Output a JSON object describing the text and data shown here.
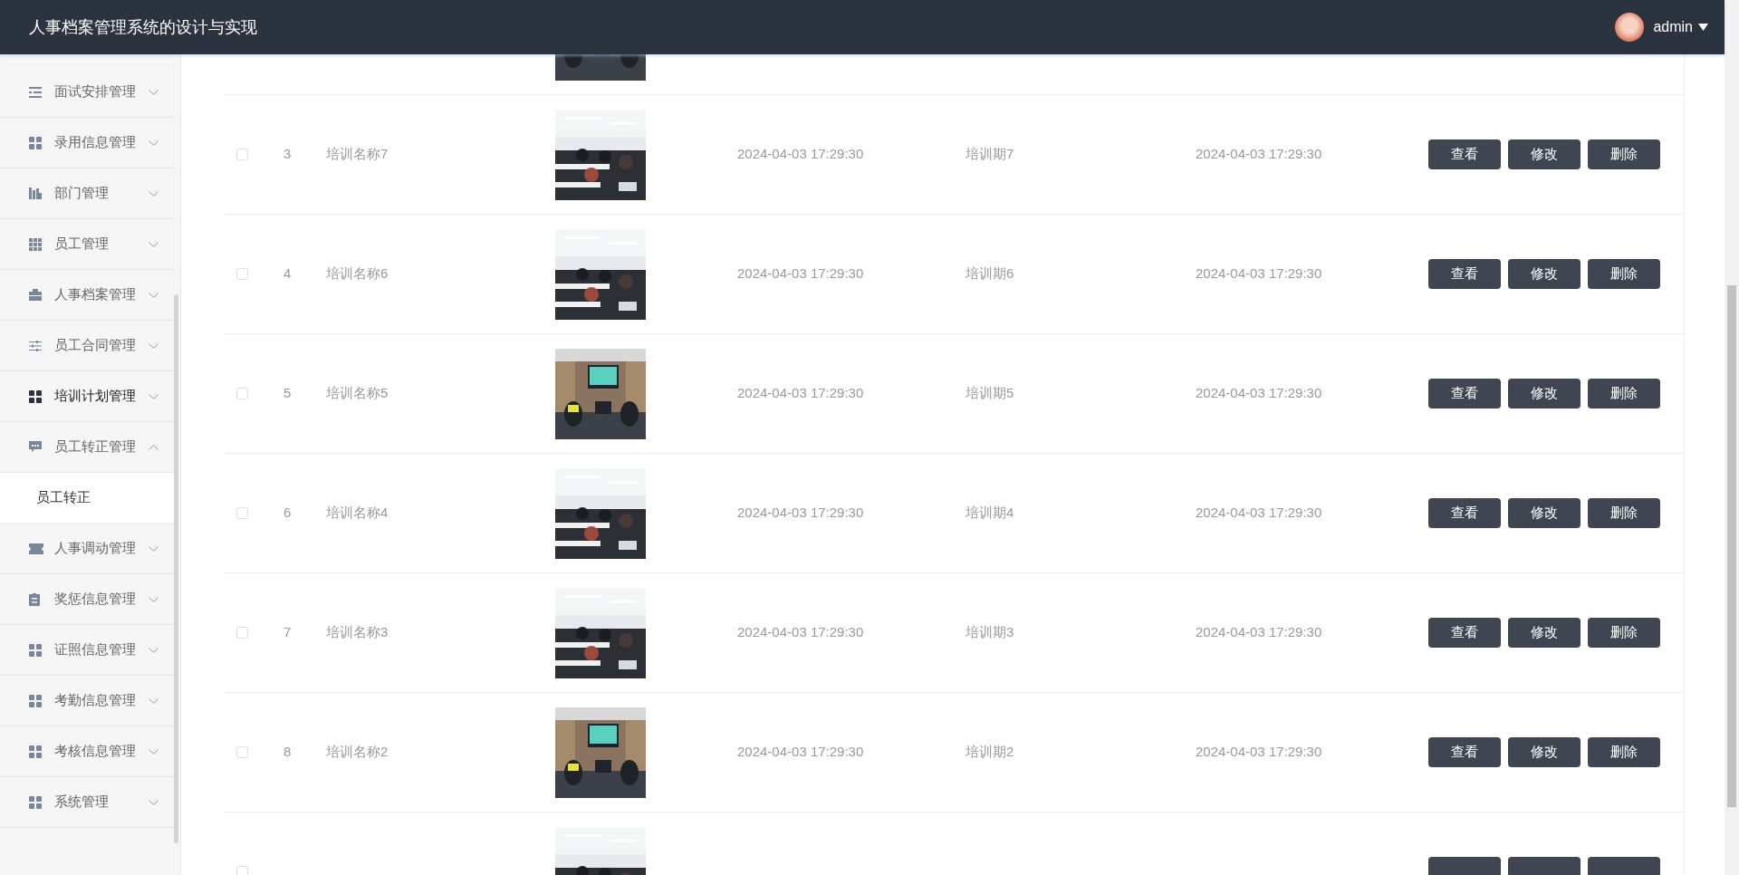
{
  "header": {
    "title": "人事档案管理系统的设计与实现",
    "user": "admin"
  },
  "sidebar": {
    "items": [
      {
        "label": "面试安排管理",
        "expanded": false,
        "selected": false
      },
      {
        "label": "录用信息管理",
        "expanded": false,
        "selected": false
      },
      {
        "label": "部门管理",
        "expanded": false,
        "selected": false
      },
      {
        "label": "员工管理",
        "expanded": false,
        "selected": false
      },
      {
        "label": "人事档案管理",
        "expanded": false,
        "selected": false
      },
      {
        "label": "员工合同管理",
        "expanded": false,
        "selected": false
      },
      {
        "label": "培训计划管理",
        "expanded": false,
        "selected": true
      },
      {
        "label": "员工转正管理",
        "expanded": true,
        "selected": false,
        "children": [
          {
            "label": "员工转正"
          }
        ]
      },
      {
        "label": "人事调动管理",
        "expanded": false,
        "selected": false
      },
      {
        "label": "奖惩信息管理",
        "expanded": false,
        "selected": false
      },
      {
        "label": "证照信息管理",
        "expanded": false,
        "selected": false
      },
      {
        "label": "考勤信息管理",
        "expanded": false,
        "selected": false
      },
      {
        "label": "考核信息管理",
        "expanded": false,
        "selected": false
      },
      {
        "label": "系统管理",
        "expanded": false,
        "selected": false
      }
    ]
  },
  "table": {
    "rows": [
      {
        "kind": "cut_top"
      },
      {
        "kind": "full",
        "checked": false,
        "index": "3",
        "name": "培训名称7",
        "created": "2024-04-03 17:29:30",
        "period": "培训期7",
        "time": "2024-04-03 17:29:30",
        "buttons": [
          "查看",
          "修改",
          "删除"
        ]
      },
      {
        "kind": "full",
        "checked": false,
        "index": "4",
        "name": "培训名称6",
        "created": "2024-04-03 17:29:30",
        "period": "培训期6",
        "time": "2024-04-03 17:29:30",
        "buttons": [
          "查看",
          "修改",
          "删除"
        ]
      },
      {
        "kind": "full",
        "checked": false,
        "index": "5",
        "name": "培训名称5",
        "created": "2024-04-03 17:29:30",
        "period": "培训期5",
        "time": "2024-04-03 17:29:30",
        "buttons": [
          "查看",
          "修改",
          "删除"
        ]
      },
      {
        "kind": "full",
        "checked": false,
        "index": "6",
        "name": "培训名称4",
        "created": "2024-04-03 17:29:30",
        "period": "培训期4",
        "time": "2024-04-03 17:29:30",
        "buttons": [
          "查看",
          "修改",
          "删除"
        ]
      },
      {
        "kind": "full",
        "checked": false,
        "index": "7",
        "name": "培训名称3",
        "created": "2024-04-03 17:29:30",
        "period": "培训期3",
        "time": "2024-04-03 17:29:30",
        "buttons": [
          "查看",
          "修改",
          "删除"
        ]
      },
      {
        "kind": "full",
        "checked": false,
        "index": "8",
        "name": "培训名称2",
        "created": "2024-04-03 17:29:30",
        "period": "培训期2",
        "time": "2024-04-03 17:29:30",
        "buttons": [
          "查看",
          "修改",
          "删除"
        ]
      },
      {
        "kind": "cut_bottom",
        "checked": false
      }
    ]
  }
}
